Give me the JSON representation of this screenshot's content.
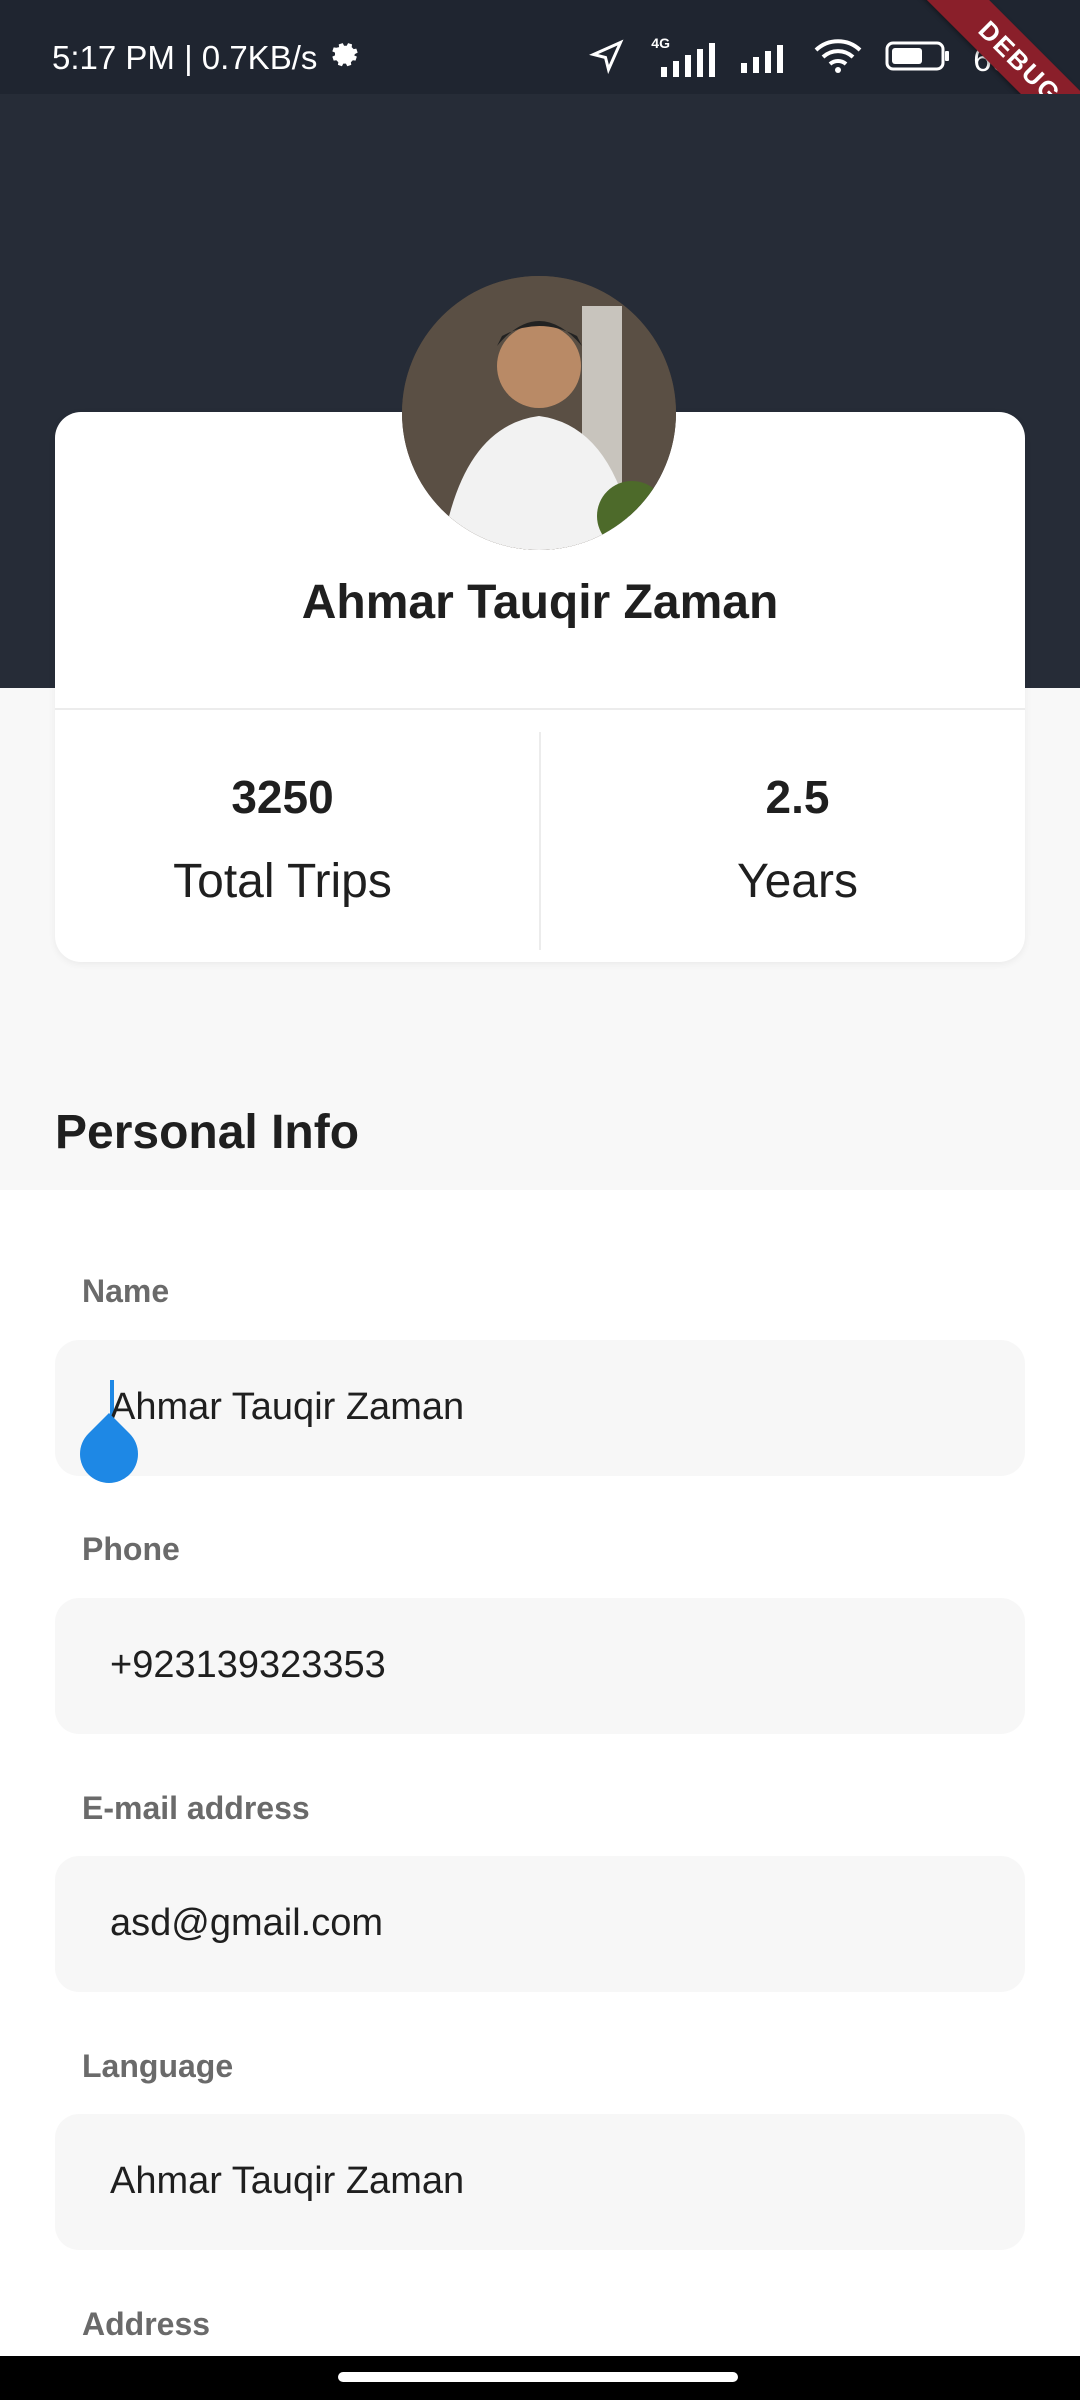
{
  "status_bar": {
    "time_speed": "5:17 PM | 0.7KB/s",
    "network_badge": "4G",
    "battery_text": "60",
    "debug_label": "DEBUG"
  },
  "profile": {
    "name": "Ahmar Tauqir Zaman",
    "stats": [
      {
        "value": "3250",
        "label": "Total Trips"
      },
      {
        "value": "2.5",
        "label": "Years"
      }
    ]
  },
  "personal_info": {
    "title": "Personal Info",
    "fields": [
      {
        "label": "Name",
        "value": "Ahmar Tauqir Zaman"
      },
      {
        "label": "Phone",
        "value": "+923139323353"
      },
      {
        "label": "E-mail address",
        "value": "asd@gmail.com"
      },
      {
        "label": "Language",
        "value": "Ahmar Tauqir Zaman"
      },
      {
        "label": "Address",
        "value": ""
      }
    ]
  },
  "colors": {
    "header": "#262c37",
    "accent": "#1e88e5",
    "debug_ribbon": "#8a1f2a"
  }
}
